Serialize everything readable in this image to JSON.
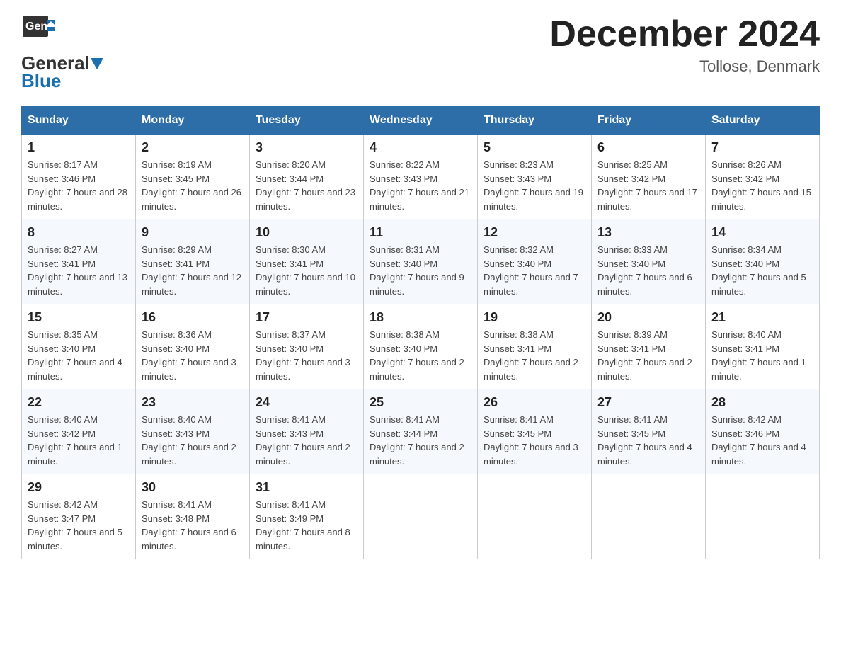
{
  "header": {
    "logo_general": "General",
    "logo_blue": "Blue",
    "title": "December 2024",
    "subtitle": "Tollose, Denmark"
  },
  "weekdays": [
    "Sunday",
    "Monday",
    "Tuesday",
    "Wednesday",
    "Thursday",
    "Friday",
    "Saturday"
  ],
  "weeks": [
    [
      {
        "day": "1",
        "sunrise": "8:17 AM",
        "sunset": "3:46 PM",
        "daylight": "7 hours and 28 minutes."
      },
      {
        "day": "2",
        "sunrise": "8:19 AM",
        "sunset": "3:45 PM",
        "daylight": "7 hours and 26 minutes."
      },
      {
        "day": "3",
        "sunrise": "8:20 AM",
        "sunset": "3:44 PM",
        "daylight": "7 hours and 23 minutes."
      },
      {
        "day": "4",
        "sunrise": "8:22 AM",
        "sunset": "3:43 PM",
        "daylight": "7 hours and 21 minutes."
      },
      {
        "day": "5",
        "sunrise": "8:23 AM",
        "sunset": "3:43 PM",
        "daylight": "7 hours and 19 minutes."
      },
      {
        "day": "6",
        "sunrise": "8:25 AM",
        "sunset": "3:42 PM",
        "daylight": "7 hours and 17 minutes."
      },
      {
        "day": "7",
        "sunrise": "8:26 AM",
        "sunset": "3:42 PM",
        "daylight": "7 hours and 15 minutes."
      }
    ],
    [
      {
        "day": "8",
        "sunrise": "8:27 AM",
        "sunset": "3:41 PM",
        "daylight": "7 hours and 13 minutes."
      },
      {
        "day": "9",
        "sunrise": "8:29 AM",
        "sunset": "3:41 PM",
        "daylight": "7 hours and 12 minutes."
      },
      {
        "day": "10",
        "sunrise": "8:30 AM",
        "sunset": "3:41 PM",
        "daylight": "7 hours and 10 minutes."
      },
      {
        "day": "11",
        "sunrise": "8:31 AM",
        "sunset": "3:40 PM",
        "daylight": "7 hours and 9 minutes."
      },
      {
        "day": "12",
        "sunrise": "8:32 AM",
        "sunset": "3:40 PM",
        "daylight": "7 hours and 7 minutes."
      },
      {
        "day": "13",
        "sunrise": "8:33 AM",
        "sunset": "3:40 PM",
        "daylight": "7 hours and 6 minutes."
      },
      {
        "day": "14",
        "sunrise": "8:34 AM",
        "sunset": "3:40 PM",
        "daylight": "7 hours and 5 minutes."
      }
    ],
    [
      {
        "day": "15",
        "sunrise": "8:35 AM",
        "sunset": "3:40 PM",
        "daylight": "7 hours and 4 minutes."
      },
      {
        "day": "16",
        "sunrise": "8:36 AM",
        "sunset": "3:40 PM",
        "daylight": "7 hours and 3 minutes."
      },
      {
        "day": "17",
        "sunrise": "8:37 AM",
        "sunset": "3:40 PM",
        "daylight": "7 hours and 3 minutes."
      },
      {
        "day": "18",
        "sunrise": "8:38 AM",
        "sunset": "3:40 PM",
        "daylight": "7 hours and 2 minutes."
      },
      {
        "day": "19",
        "sunrise": "8:38 AM",
        "sunset": "3:41 PM",
        "daylight": "7 hours and 2 minutes."
      },
      {
        "day": "20",
        "sunrise": "8:39 AM",
        "sunset": "3:41 PM",
        "daylight": "7 hours and 2 minutes."
      },
      {
        "day": "21",
        "sunrise": "8:40 AM",
        "sunset": "3:41 PM",
        "daylight": "7 hours and 1 minute."
      }
    ],
    [
      {
        "day": "22",
        "sunrise": "8:40 AM",
        "sunset": "3:42 PM",
        "daylight": "7 hours and 1 minute."
      },
      {
        "day": "23",
        "sunrise": "8:40 AM",
        "sunset": "3:43 PM",
        "daylight": "7 hours and 2 minutes."
      },
      {
        "day": "24",
        "sunrise": "8:41 AM",
        "sunset": "3:43 PM",
        "daylight": "7 hours and 2 minutes."
      },
      {
        "day": "25",
        "sunrise": "8:41 AM",
        "sunset": "3:44 PM",
        "daylight": "7 hours and 2 minutes."
      },
      {
        "day": "26",
        "sunrise": "8:41 AM",
        "sunset": "3:45 PM",
        "daylight": "7 hours and 3 minutes."
      },
      {
        "day": "27",
        "sunrise": "8:41 AM",
        "sunset": "3:45 PM",
        "daylight": "7 hours and 4 minutes."
      },
      {
        "day": "28",
        "sunrise": "8:42 AM",
        "sunset": "3:46 PM",
        "daylight": "7 hours and 4 minutes."
      }
    ],
    [
      {
        "day": "29",
        "sunrise": "8:42 AM",
        "sunset": "3:47 PM",
        "daylight": "7 hours and 5 minutes."
      },
      {
        "day": "30",
        "sunrise": "8:41 AM",
        "sunset": "3:48 PM",
        "daylight": "7 hours and 6 minutes."
      },
      {
        "day": "31",
        "sunrise": "8:41 AM",
        "sunset": "3:49 PM",
        "daylight": "7 hours and 8 minutes."
      },
      {
        "day": "",
        "sunrise": "",
        "sunset": "",
        "daylight": ""
      },
      {
        "day": "",
        "sunrise": "",
        "sunset": "",
        "daylight": ""
      },
      {
        "day": "",
        "sunrise": "",
        "sunset": "",
        "daylight": ""
      },
      {
        "day": "",
        "sunrise": "",
        "sunset": "",
        "daylight": ""
      }
    ]
  ]
}
